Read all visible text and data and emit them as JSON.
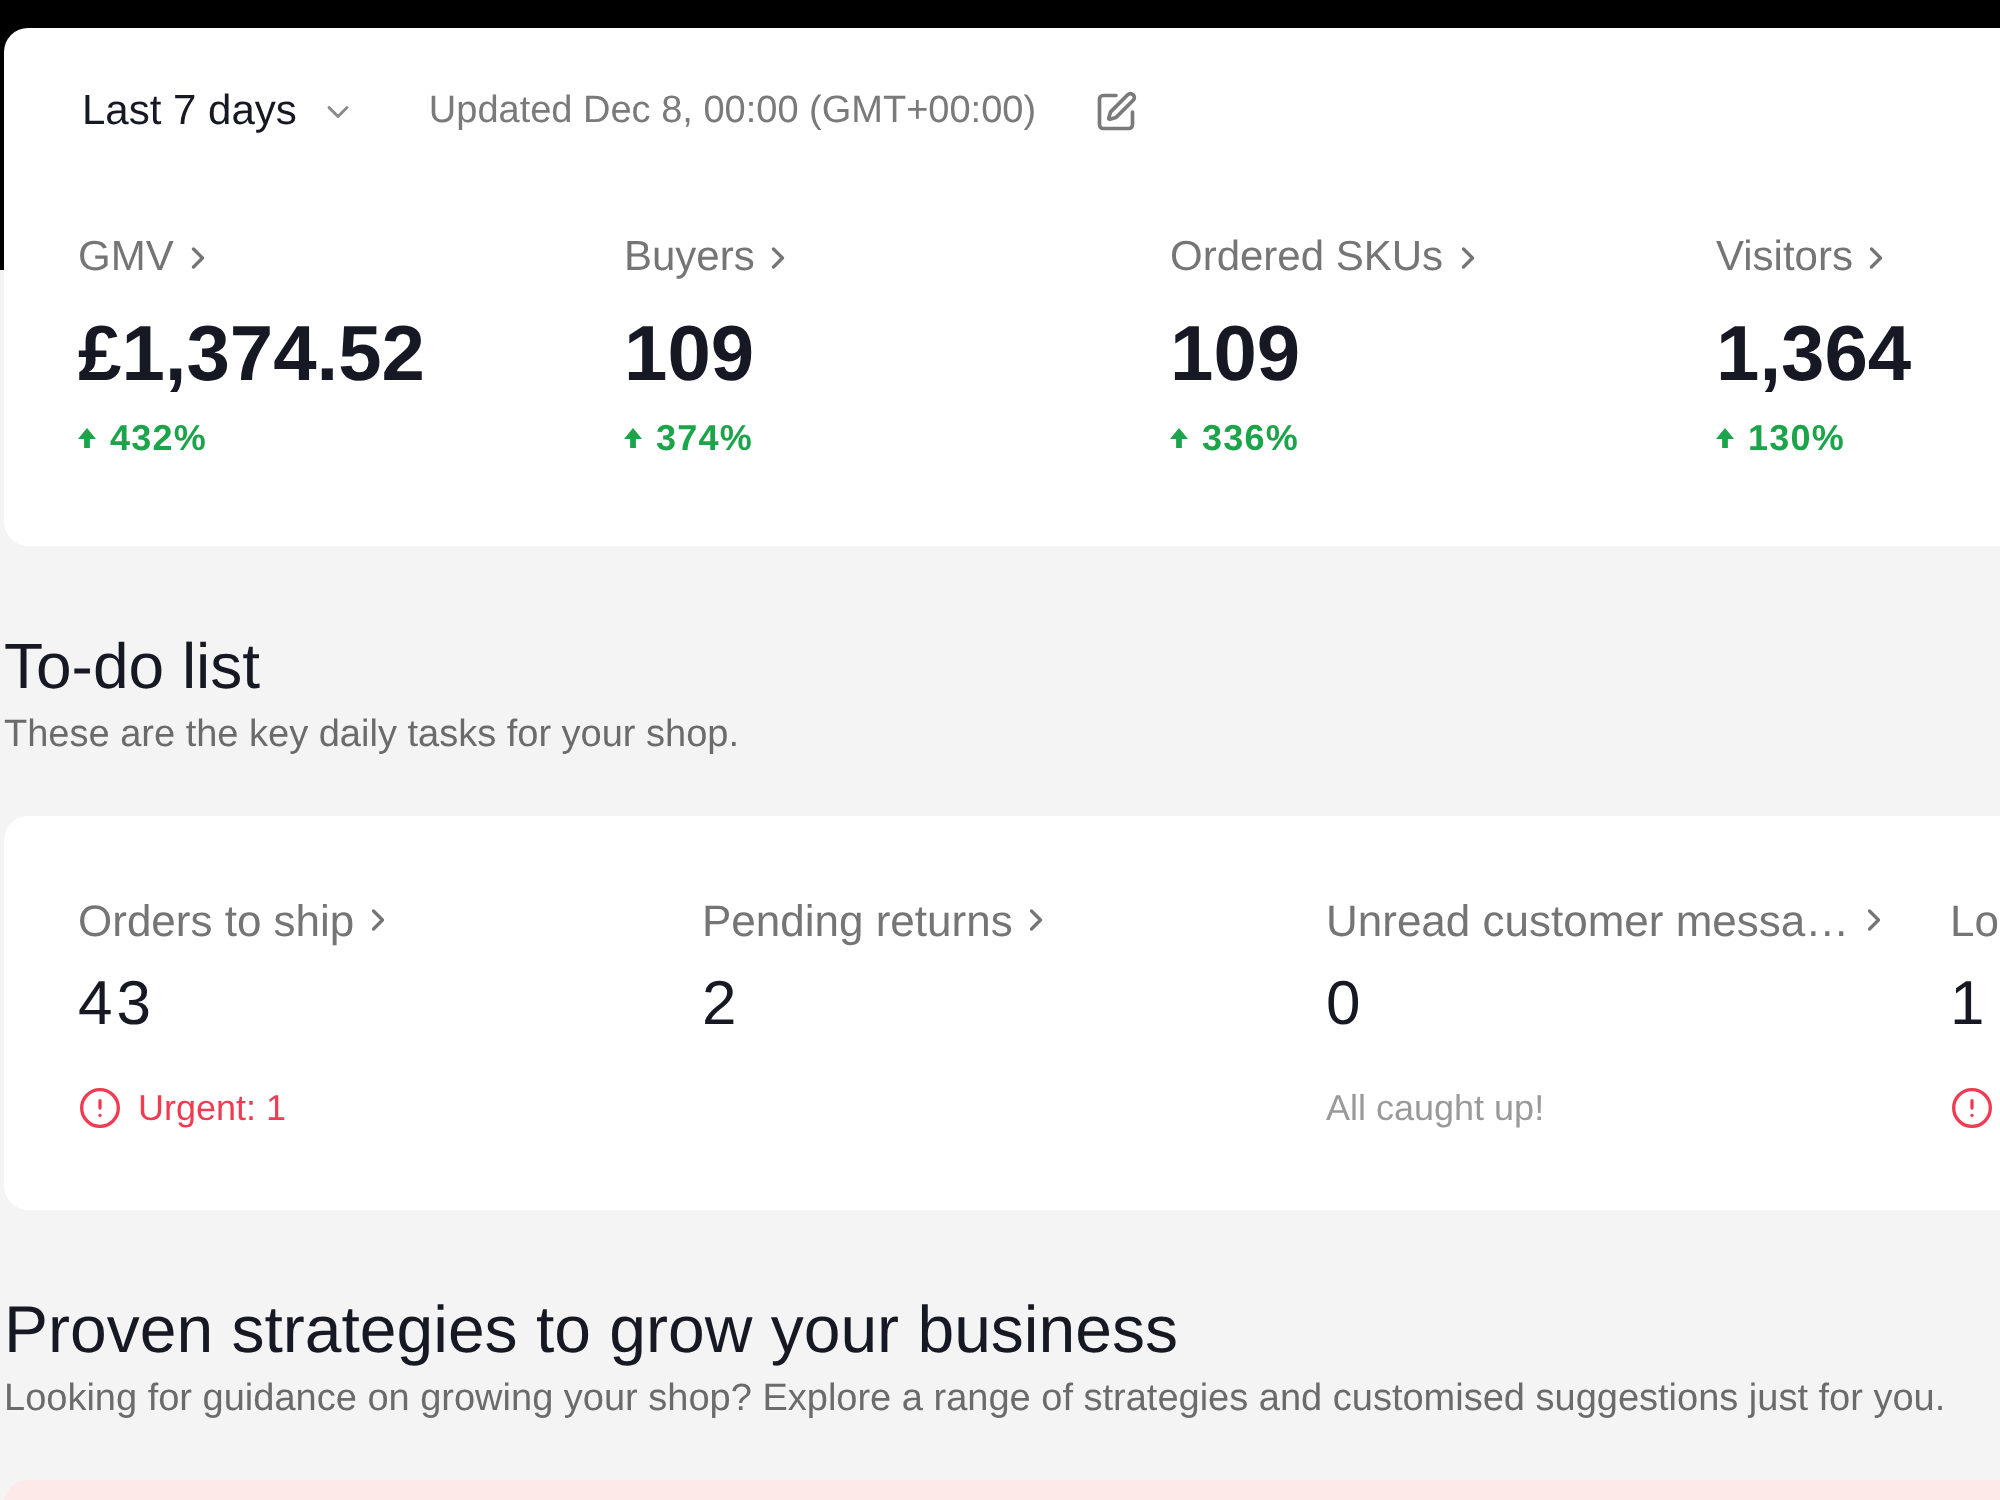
{
  "overview": {
    "date_range": {
      "label": "Last 7 days"
    },
    "updated": "Updated Dec 8, 00:00 (GMT+00:00)",
    "metrics": [
      {
        "label": "GMV",
        "value": "£1,374.52",
        "change": {
          "kind": "up",
          "text": "432%"
        }
      },
      {
        "label": "Buyers",
        "value": "109",
        "change": {
          "kind": "up",
          "text": "374%"
        }
      },
      {
        "label": "Ordered SKUs",
        "value": "109",
        "change": {
          "kind": "up",
          "text": "336%"
        }
      },
      {
        "label": "Visitors",
        "value": "1,364",
        "change": {
          "kind": "up",
          "text": "130%"
        }
      }
    ]
  },
  "todo": {
    "title": "To-do list",
    "subtitle": "These are the key daily tasks for your shop.",
    "items": [
      {
        "label": "Orders to ship",
        "link": true,
        "value": "43",
        "status": {
          "kind": "urgent",
          "text": "Urgent: 1"
        }
      },
      {
        "label": "Pending returns",
        "link": true,
        "value": "2"
      },
      {
        "label": "Unread customer messa…",
        "link": true,
        "value": "0",
        "status": {
          "kind": "note",
          "text": "All caught up!"
        }
      },
      {
        "label": "Lo",
        "value": "1",
        "status": {
          "kind": "urgent"
        }
      }
    ]
  },
  "strategies": {
    "title": "Proven strategies to grow your business",
    "subtitle": "Looking for guidance on growing your shop? Explore a range of strategies and customised suggestions just for you."
  }
}
